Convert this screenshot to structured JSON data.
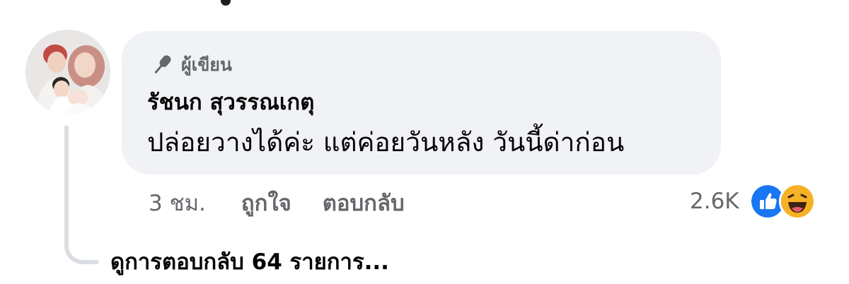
{
  "comment": {
    "badge": {
      "label": "ผู้เขียน",
      "icon": "microphone-icon"
    },
    "author": "รัชนก สุวรรณเกตุ",
    "text": "ปล่อยวางได้ค่ะ แต่ค่อยวันหลัง วันนี้ด่าก่อน",
    "bubble_color": "#f0f2f5"
  },
  "actions": {
    "time": "3 ชม.",
    "like_label": "ถูกใจ",
    "reply_label": "ตอบกลับ"
  },
  "reactions": {
    "count": "2.6K",
    "icons": [
      "like-reaction-icon",
      "haha-reaction-icon"
    ],
    "like_color": "#1877f2",
    "haha_color": "#f7b125"
  },
  "replies_link": "ดูการตอบกลับ 64 รายการ..."
}
